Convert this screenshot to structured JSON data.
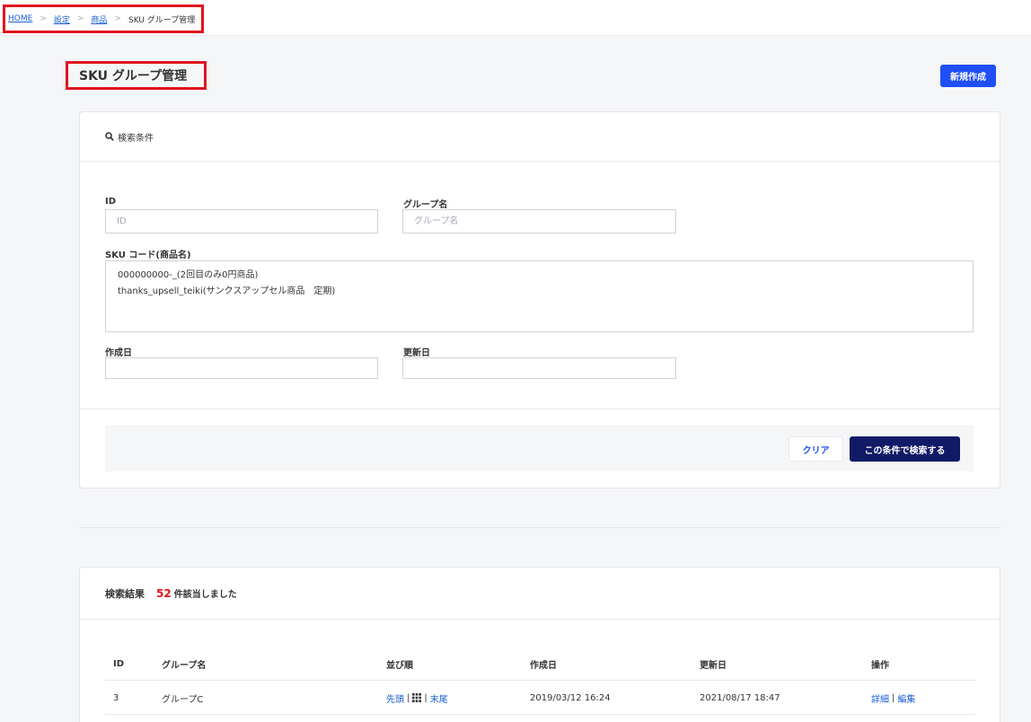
{
  "breadcrumb": {
    "home": "HOME",
    "settings": "設定",
    "products": "商品",
    "current": "SKU グループ管理",
    "separator": ">"
  },
  "page": {
    "title": "SKU グループ管理",
    "new_button": "新規作成"
  },
  "search": {
    "heading": "検索条件",
    "id_label": "ID",
    "id_placeholder": "ID",
    "group_label": "グループ名",
    "group_placeholder": "グループ名",
    "sku_label": "SKU コード(商品名)",
    "sku_lines": [
      "000000000-_(2回目のみ0円商品)",
      "thanks_upsell_teiki(サンクスアップセル商品　定期)"
    ],
    "created_label": "作成日",
    "updated_label": "更新日",
    "clear_button": "クリア",
    "search_button": "この条件で検索する"
  },
  "results": {
    "heading": "検索結果",
    "count": "52",
    "count_suffix": "件該当しました",
    "columns": [
      "ID",
      "グループ名",
      "並び順",
      "作成日",
      "更新日",
      "操作"
    ],
    "rows": [
      {
        "id": "3",
        "group": "グループC",
        "order_first": "先頭",
        "order_last": "末尾",
        "created": "2019/03/12 16:24",
        "updated": "2021/08/17 18:47",
        "detail": "詳細",
        "edit": "編集"
      }
    ]
  },
  "colors": {
    "accent": "#1f4ff5",
    "navy": "#111a66",
    "highlight": "#e0141e"
  }
}
